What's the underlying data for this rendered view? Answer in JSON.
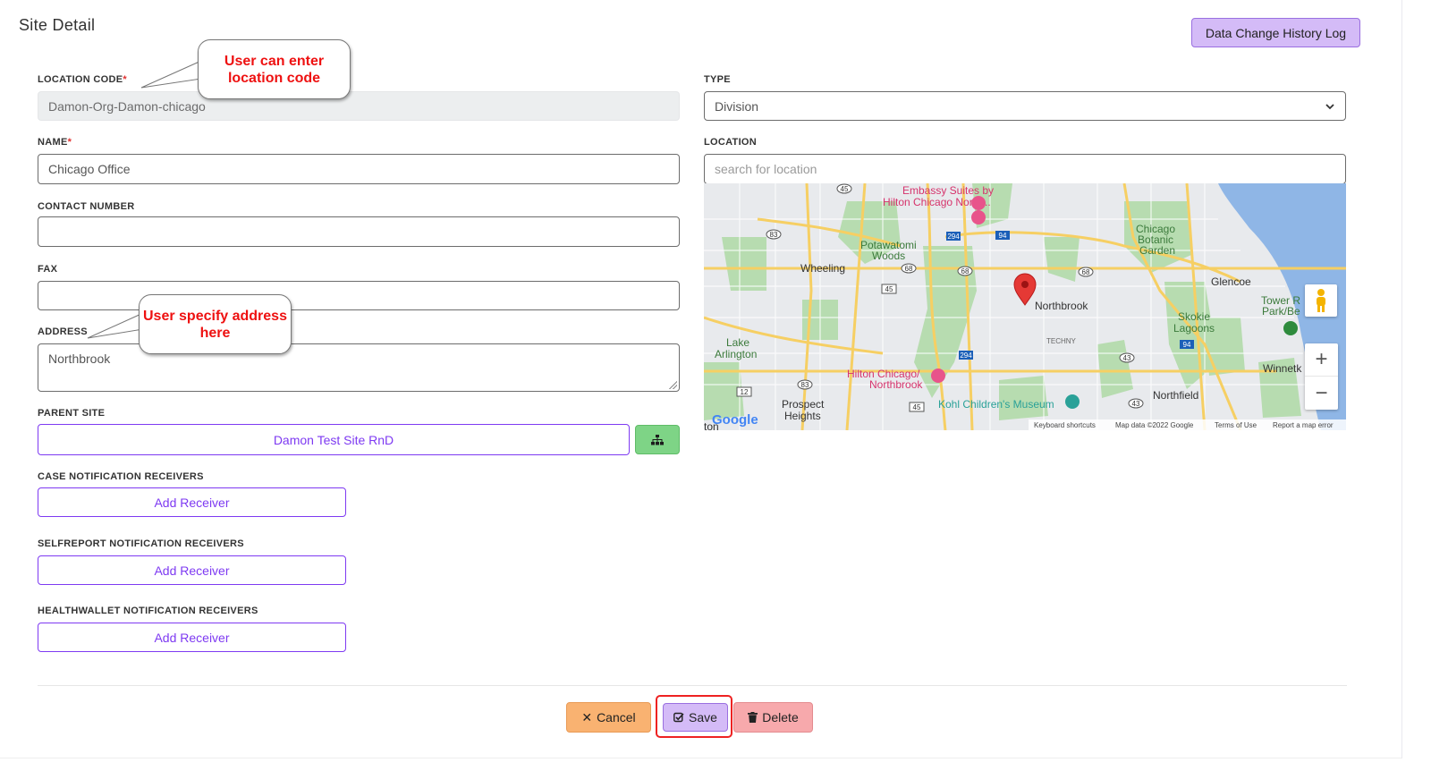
{
  "header": {
    "title": "Site Detail",
    "history_button": "Data Change History Log"
  },
  "form": {
    "location_code": {
      "label": "LOCATION CODE",
      "required_mark": "*",
      "value": "Damon-Org-Damon-chicago"
    },
    "name": {
      "label": "NAME",
      "required_mark": "*",
      "value": "Chicago Office"
    },
    "contact_number": {
      "label": "CONTACT NUMBER",
      "value": ""
    },
    "fax": {
      "label": "FAX",
      "value": ""
    },
    "address": {
      "label": "ADDRESS",
      "value": "Northbrook"
    },
    "parent_site": {
      "label": "PARENT SITE",
      "value": "Damon Test Site RnD"
    },
    "case_receivers": {
      "label": "CASE NOTIFICATION RECEIVERS",
      "button": "Add Receiver"
    },
    "selfreport_receivers": {
      "label": "SELFREPORT NOTIFICATION RECEIVERS",
      "button": "Add Receiver"
    },
    "healthwallet_receivers": {
      "label": "HEALTHWALLET NOTIFICATION RECEIVERS",
      "button": "Add Receiver"
    },
    "type": {
      "label": "TYPE",
      "selected": "Division"
    },
    "location": {
      "label": "LOCATION",
      "placeholder": "search for location"
    }
  },
  "map": {
    "places": {
      "embassy": "Embassy Suites by",
      "embassy2": "Hilton Chicago North...",
      "potawatomi": "Potawatomi",
      "woods": "Woods",
      "botanic1": "Chicago",
      "botanic2": "Botanic",
      "botanic3": "Garden",
      "wheeling": "Wheeling",
      "glencoe": "Glencoe",
      "northbrook": "Northbrook",
      "skokie1": "Skokie",
      "skokie2": "Lagoons",
      "tower1": "Tower R",
      "tower2": "Park/Be",
      "techny": "TECHNY",
      "lake1": "Lake",
      "lake2": "Arlington",
      "hilton1": "Hilton Chicago/",
      "hilton2": "Northbrook",
      "winnetka": "Winnetk",
      "northfield": "Northfield",
      "prospect1": "Prospect",
      "prospect2": "Heights",
      "kohl": "Kohl Children's Museum",
      "ton": "ton"
    },
    "routes": [
      "45",
      "83",
      "294",
      "94",
      "68",
      "68",
      "68",
      "45",
      "294",
      "43",
      "94",
      "12",
      "83",
      "45",
      "43"
    ],
    "google_logo": "Google",
    "footer": {
      "shortcuts": "Keyboard shortcuts",
      "mapdata": "Map data ©2022 Google",
      "terms": "Terms of Use",
      "report": "Report a map error"
    },
    "zoom_in": "+",
    "zoom_out": "−"
  },
  "callouts": {
    "location_code": "User can enter location code",
    "address": "User specify address here"
  },
  "actions": {
    "cancel": "Cancel",
    "save": "Save",
    "delete": "Delete"
  },
  "icons": {
    "cancel": "x-icon",
    "save": "check-square-icon",
    "delete": "trash-icon",
    "parent_tree": "sitemap-icon",
    "pegman": "pegman-icon",
    "map_pin": "map-pin-icon"
  },
  "colors": {
    "accent_purple": "#7e3af2",
    "save_bg": "#d4bbf7",
    "cancel_bg": "#f9b271",
    "delete_bg": "#f7a9ac",
    "tree_bg": "#7ed486",
    "required": "#e0302f",
    "callout_text": "#ee1111"
  }
}
